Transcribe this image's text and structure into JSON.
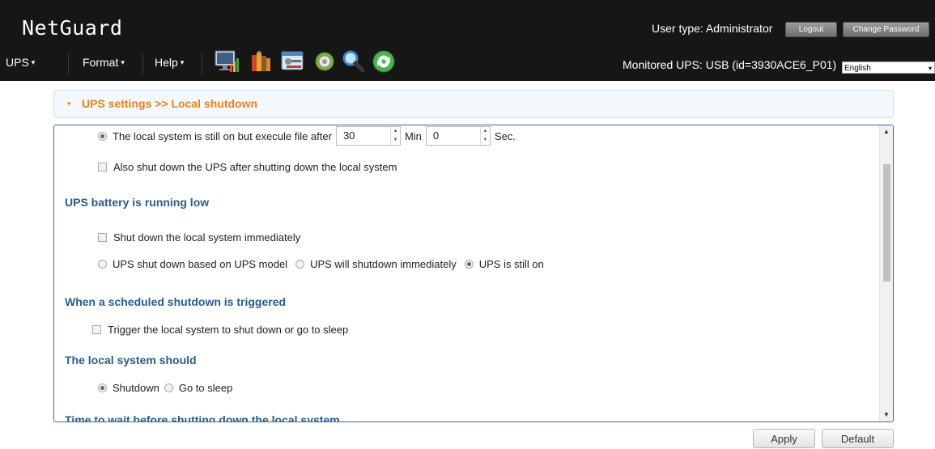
{
  "header": {
    "logo": "NetGuard",
    "user_type": "User type: Administrator",
    "logout_label": "Logout",
    "change_password_label": "Change Password"
  },
  "menu": {
    "items": [
      {
        "label": "UPS"
      },
      {
        "label": "Format"
      },
      {
        "label": "Help"
      }
    ],
    "dropdown_arrow": "▾",
    "toolbar_icons": [
      "monitor-chart-icon",
      "battery-books-icon",
      "settings-tools-icon",
      "gear-icon",
      "search-magnifier-icon",
      "refresh-icon"
    ],
    "monitored_ups": "Monitored UPS: USB (id=3930ACE6_P01)",
    "language": "English"
  },
  "panel": {
    "title": "UPS settings >> Local shutdown"
  },
  "content": {
    "execute_after": {
      "label": "The local system is still on but execule file after",
      "min_value": "30",
      "min_unit": "Min",
      "sec_value": "0",
      "sec_unit": "Sec.",
      "selected": true
    },
    "also_shutdown_ups": "Also shut down the UPS after shutting down the local system",
    "battery_low": {
      "title": "UPS battery is running low",
      "shutdown_immediately": "Shut down the local system immediately",
      "options": [
        {
          "label": "UPS shut down based on UPS model",
          "selected": false
        },
        {
          "label": "UPS will shutdown immediately",
          "selected": false
        },
        {
          "label": "UPS is still on",
          "selected": true
        }
      ]
    },
    "scheduled": {
      "title": "When a scheduled shutdown is triggered",
      "trigger_label": "Trigger the local system to shut down or go to sleep"
    },
    "system_should": {
      "title": "The local system should",
      "options": [
        {
          "label": "Shutdown",
          "selected": true
        },
        {
          "label": "Go to sleep",
          "selected": false
        }
      ]
    },
    "time_to_wait_title": "Time to wait before shutting down the local system"
  },
  "footer": {
    "apply_label": "Apply",
    "default_label": "Default"
  },
  "colors": {
    "topbar_bg": "#161616",
    "accent_orange": "#e6821e",
    "section_blue": "#2b5b8a",
    "panel_border": "#2e6da4"
  }
}
